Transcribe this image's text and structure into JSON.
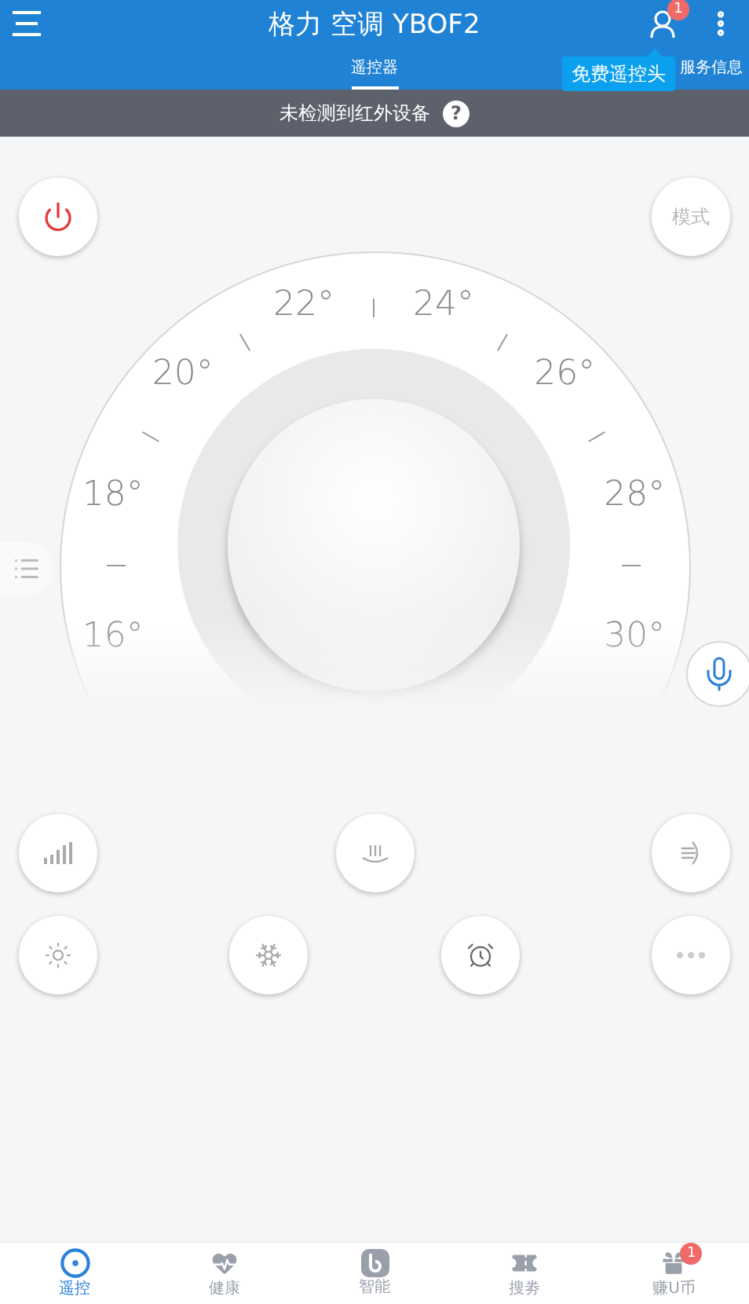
{
  "header": {
    "title": "格力 空调 YBOF2",
    "badge": "1"
  },
  "tabs": [
    {
      "label": "遥控器",
      "selected": true
    },
    {
      "label": "服务信息",
      "selected": false
    }
  ],
  "tooltip": "免费遥控头",
  "alert": {
    "text": "未检测到红外设备",
    "help": "?"
  },
  "mode_button": "模式",
  "temperatures": [
    "16°",
    "18°",
    "20°",
    "22°",
    "24°",
    "26°",
    "28°",
    "30°"
  ],
  "controls": [
    [
      {
        "kind": "fan"
      },
      {
        "kind": "swing"
      },
      {
        "kind": "wind"
      }
    ],
    [
      {
        "kind": "sun"
      },
      {
        "kind": "snow"
      },
      {
        "kind": "timer"
      },
      {
        "kind": "more"
      }
    ]
  ],
  "nav": [
    {
      "label": "遥控",
      "kind": "remote",
      "selected": true
    },
    {
      "label": "健康",
      "kind": "health",
      "selected": false
    },
    {
      "label": "智能",
      "kind": "smart",
      "selected": false
    },
    {
      "label": "搜劵",
      "kind": "coupon",
      "selected": false
    },
    {
      "label": "赚U币",
      "kind": "gift",
      "selected": false,
      "badge": "1"
    }
  ]
}
